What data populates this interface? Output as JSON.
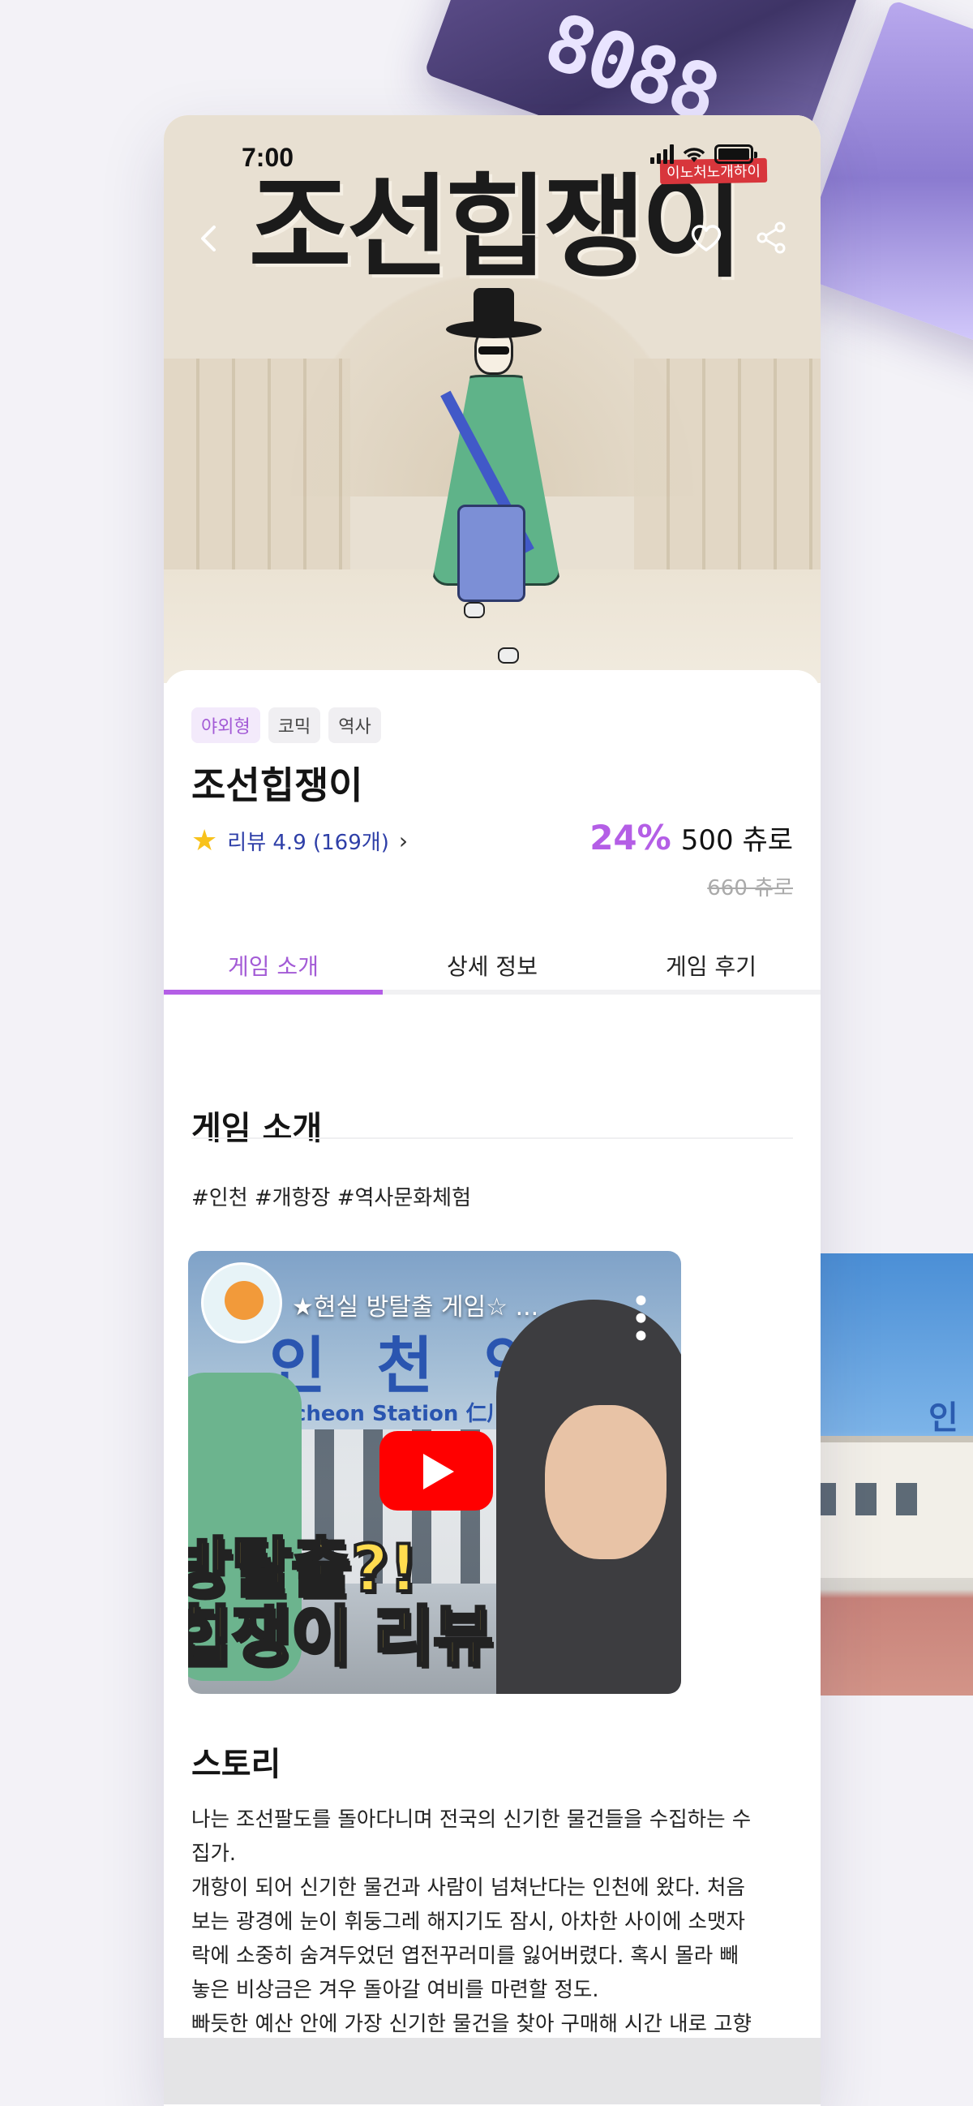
{
  "background": {
    "card1_text": "8088"
  },
  "status_bar": {
    "time": "7:00"
  },
  "hero": {
    "title": "조선힙쟁이",
    "stamp": "이노처노개하이"
  },
  "game": {
    "tags": [
      "야외형",
      "코믹",
      "역사"
    ],
    "title": "조선힙쟁이",
    "rating_text": "리뷰 4.9 (169개)",
    "discount_percent": "24%",
    "price": "500 츄로",
    "original_price": "660 츄로"
  },
  "tabs": [
    {
      "label": "게임 소개",
      "active": true
    },
    {
      "label": "상세 정보",
      "active": false
    },
    {
      "label": "게임 후기",
      "active": false
    }
  ],
  "intro": {
    "heading": "게임 소개",
    "hashtags": "#인천 #개항장 #역사문화체험",
    "video": {
      "title": "★현실 방탈출 게임☆ ...",
      "station_ko": "인 천 역",
      "station_en": "cheon Station 仁川驛",
      "overlay_line1": "방탈출?!",
      "overlay_line2": "힙쟁이 리뷰"
    },
    "side_image_text": "인"
  },
  "story": {
    "heading": "스토리",
    "lines": [
      "나는 조선팔도를 돌아다니며 전국의 신기한 물건들을 수집하는 수",
      "집가.",
      "개항이 되어 신기한 물건과 사람이 넘쳐난다는 인천에 왔다. 처음",
      "보는 광경에 눈이 휘둥그레 해지기도 잠시, 아차한 사이에 소맷자",
      "락에 소중히 숨겨두었던 엽전꾸러미를 잃어버렸다. 혹시 몰라 빼",
      "놓은 비상금은 겨우 돌아갈 여비를 마련할 정도.",
      "빠듯한 예산 안에 가장 신기한 물건을 찾아 구매해 시간 내로 고향"
    ]
  },
  "colors": {
    "accent": "#b45ee6",
    "rating_text": "#2e3fa8",
    "star": "#f8c21c",
    "play_button": "#ff0000"
  },
  "icons": [
    "back-arrow-icon",
    "heart-icon",
    "share-icon",
    "star-icon",
    "chevron-right-icon",
    "youtube-play-icon",
    "more-vertical-icon"
  ]
}
